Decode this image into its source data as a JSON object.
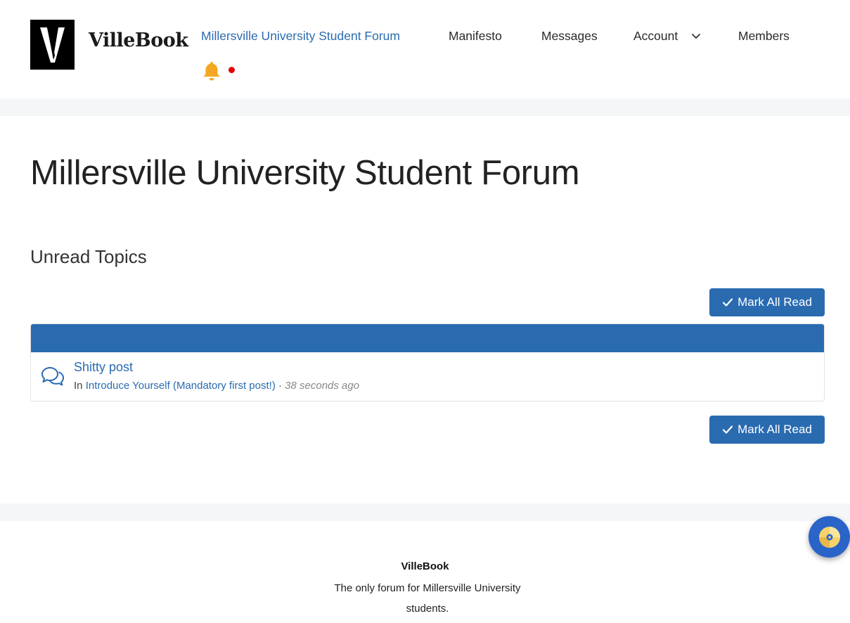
{
  "brand": {
    "name": "VilleBook",
    "logo_letter": "V"
  },
  "nav": {
    "items": [
      {
        "label": "Millersville University Student Forum",
        "active": true
      },
      {
        "label": "Manifesto"
      },
      {
        "label": "Messages"
      },
      {
        "label": "Account"
      },
      {
        "label": "Members"
      }
    ],
    "notification_icon": "bell-icon",
    "account_icon": "chevron-down-icon"
  },
  "page": {
    "title": "Millersville University Student Forum",
    "section_title": "Unread Topics",
    "mark_all_read_label": "Mark All Read"
  },
  "topics": [
    {
      "title": "Shitty post",
      "in_label": "In",
      "category": "Introduce Yourself (Mandatory first post!)",
      "separator": "·",
      "time": "38 seconds ago",
      "icon": "chat-bubbles-icon"
    }
  ],
  "footer": {
    "brand": "VilleBook",
    "tagline": "The only forum for Millersville University students."
  },
  "colors": {
    "accent": "#2a6bb0",
    "bell": "#f5a623",
    "notification_dot": "#e60000",
    "fab": "#2a64c9"
  }
}
